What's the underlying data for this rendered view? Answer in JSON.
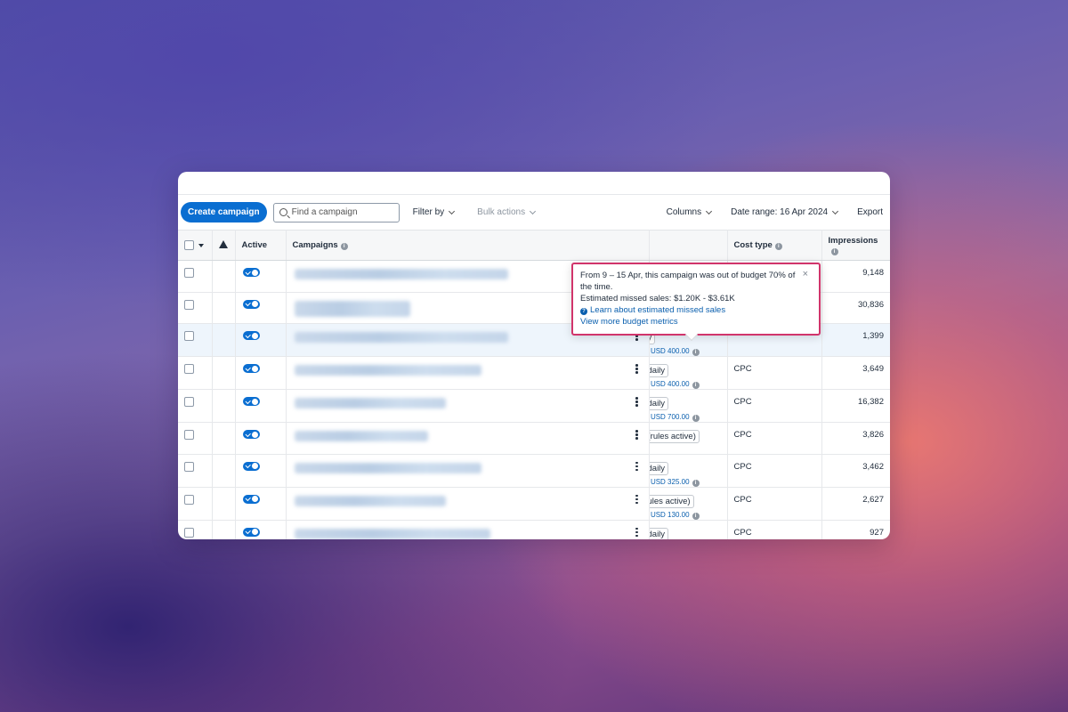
{
  "toolbar": {
    "create_label": "Create campaign",
    "search_placeholder": "Find a campaign",
    "filter_label": "Filter by",
    "bulk_label": "Bulk actions",
    "columns_label": "Columns",
    "date_range_label": "Date range: 16 Apr 2024",
    "export_label": "Export"
  },
  "table": {
    "headers": {
      "active": "Active",
      "campaigns": "Campaigns",
      "cost_type": "Cost type",
      "impressions": "Impressions"
    },
    "rows": [
      {
        "budget_pill": "",
        "budget_sub": "",
        "cost": "",
        "impressions": "9,148"
      },
      {
        "budget_pill": "",
        "budget_sub": "",
        "cost": "",
        "impressions": "30,836"
      },
      {
        "budget_pill": "y",
        "budget_sub": ": USD 400.00",
        "cost": "",
        "impressions": "1,399"
      },
      {
        "budget_pill": "daily",
        "budget_sub": ": USD 400.00",
        "cost": "CPC",
        "impressions": "3,649"
      },
      {
        "budget_pill": "daily",
        "budget_sub": ": USD 700.00",
        "cost": "CPC",
        "impressions": "16,382"
      },
      {
        "budget_pill": "(rules active)",
        "budget_sub": "",
        "cost": "CPC",
        "impressions": "3,826"
      },
      {
        "budget_pill": "daily",
        "budget_sub": ": USD 325.00",
        "cost": "CPC",
        "impressions": "3,462"
      },
      {
        "budget_pill": "ules active)",
        "budget_sub": ": USD 130.00",
        "cost": "CPC",
        "impressions": "2,627"
      },
      {
        "budget_pill": "daily",
        "budget_sub": "",
        "cost": "CPC",
        "impressions": "927"
      }
    ]
  },
  "tooltip": {
    "line1": "From 9 – 15 Apr, this campaign was out of budget 70% of the time.",
    "line2": "Estimated missed sales: $1.20K - $3.61K",
    "learn_link": "Learn about estimated missed sales",
    "metrics_link": "View more budget metrics",
    "close": "×"
  }
}
